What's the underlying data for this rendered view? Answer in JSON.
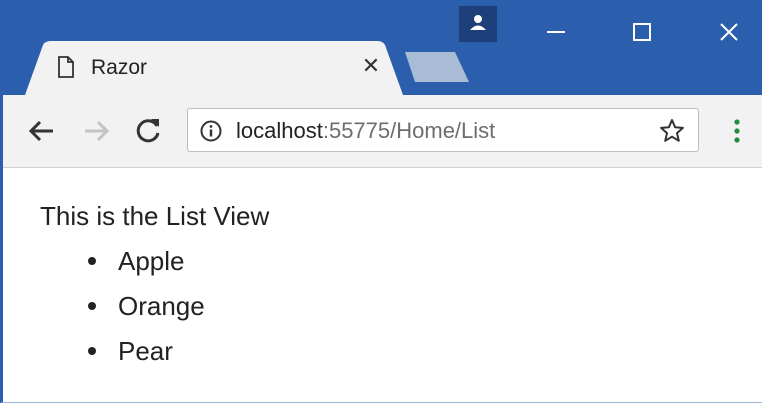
{
  "tab": {
    "title": "Razor",
    "close_glyph": "✕",
    "page_icon": "page-icon"
  },
  "address_bar": {
    "host": "localhost",
    "path": ":55775/Home/List"
  },
  "page": {
    "heading": "This is the List View",
    "items": [
      {
        "label": "Apple"
      },
      {
        "label": "Orange"
      },
      {
        "label": "Pear"
      }
    ]
  },
  "colors": {
    "titlebar": "#2b5fad",
    "toolbar": "#f2f2f2",
    "menu_dots": "#1e8e3e"
  }
}
